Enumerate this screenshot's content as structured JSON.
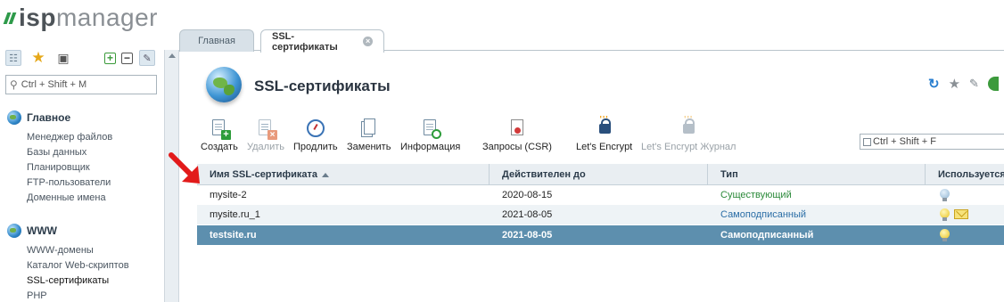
{
  "app": {
    "logo_text_bold": "isp",
    "logo_text": "manager"
  },
  "sidebar": {
    "search_placeholder": "Ctrl + Shift + M",
    "sections": [
      {
        "title": "Главное",
        "items": [
          "Менеджер файлов",
          "Базы данных",
          "Планировщик",
          "FTP-пользователи",
          "Доменные имена"
        ]
      },
      {
        "title": "WWW",
        "items": [
          "WWW-домены",
          "Каталог Web-скриптов",
          "SSL-сертификаты",
          "PHP"
        ]
      }
    ]
  },
  "tabs": [
    {
      "label": "Главная"
    },
    {
      "label": "SSL-сертификаты"
    }
  ],
  "page": {
    "title": "SSL-сертификаты"
  },
  "toolbar": {
    "create": "Создать",
    "delete": "Удалить",
    "renew": "Продлить",
    "replace": "Заменить",
    "info": "Информация",
    "csr": "Запросы (CSR)",
    "letsencrypt": "Let's Encrypt",
    "letsencrypt_log": "Let's Encrypt Журнал"
  },
  "grid_search_placeholder": "Ctrl + Shift + F",
  "table": {
    "columns": [
      "Имя SSL-сертификата",
      "Действителен до",
      "Тип",
      "Используется"
    ],
    "rows": [
      {
        "name": "mysite-2",
        "valid_until": "2020-08-15",
        "type": "Существующий",
        "used": "bulb-off-icon"
      },
      {
        "name": "mysite.ru_1",
        "valid_until": "2021-08-05",
        "type": "Самоподписанный",
        "used": "bulb-on-icon, envelope-icon"
      },
      {
        "name": "testsite.ru",
        "valid_until": "2021-08-05",
        "type": "Самоподписанный",
        "used": "bulb-on-icon"
      }
    ]
  },
  "colors": {
    "brand_green": "#2e9a4a",
    "selected_row": "#5d8fae",
    "annotation_arrow": "#e21a1a"
  }
}
